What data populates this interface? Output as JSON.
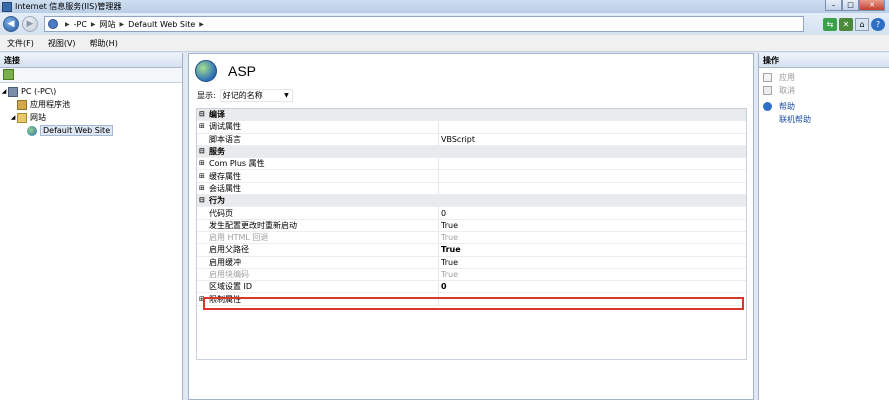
{
  "window": {
    "title": "Internet 信息服务(IIS)管理器"
  },
  "address": {
    "crumbs": [
      "-PC",
      "网站",
      "Default Web Site"
    ]
  },
  "menu": {
    "items": [
      "文件(F)",
      "视图(V)",
      "帮助(H)"
    ]
  },
  "connections": {
    "header": "连接",
    "tree": [
      {
        "label": "PC (-PC\\)",
        "icon": "server-icon",
        "toggle": "◢"
      },
      {
        "label": "应用程序池",
        "icon": "app-pool-icon",
        "toggle": ""
      },
      {
        "label": "网站",
        "icon": "sites-folder-icon",
        "toggle": "◢"
      },
      {
        "label": "Default Web Site",
        "icon": "website-globe-icon",
        "toggle": "",
        "selected": true
      }
    ]
  },
  "feature": {
    "title": "ASP",
    "display_label": "显示:",
    "display_value": "好记的名称",
    "rows": [
      {
        "type": "cat",
        "toggle": "⊟",
        "name": "编译",
        "value": ""
      },
      {
        "type": "sub",
        "toggle": "⊞",
        "name": "调试属性",
        "value": ""
      },
      {
        "type": "prop",
        "name": "脚本语言",
        "value": "VBScript"
      },
      {
        "type": "cat",
        "toggle": "⊟",
        "name": "服务",
        "value": ""
      },
      {
        "type": "sub",
        "toggle": "⊞",
        "name": "Com Plus 属性",
        "value": ""
      },
      {
        "type": "sub",
        "toggle": "⊞",
        "name": "缓存属性",
        "value": ""
      },
      {
        "type": "sub",
        "toggle": "⊞",
        "name": "会话属性",
        "value": ""
      },
      {
        "type": "cat",
        "toggle": "⊟",
        "name": "行为",
        "value": ""
      },
      {
        "type": "prop",
        "name": "代码页",
        "value": "0"
      },
      {
        "type": "prop",
        "name": "发生配置更改时重新启动",
        "value": "True"
      },
      {
        "type": "prop",
        "name": "启用 HTML 回退",
        "value": "True",
        "disabled": true
      },
      {
        "type": "prop",
        "name": "启用父路径",
        "value": "True",
        "bold": true,
        "highlight": true
      },
      {
        "type": "prop",
        "name": "启用缓冲",
        "value": "True"
      },
      {
        "type": "prop",
        "name": "启用块编码",
        "value": "True",
        "disabled": true
      },
      {
        "type": "prop",
        "name": "区域设置 ID",
        "value": "0",
        "bold": true
      },
      {
        "type": "sub",
        "toggle": "⊞",
        "name": "限制属性",
        "value": ""
      }
    ]
  },
  "actions": {
    "header": "操作",
    "items": [
      {
        "label": "应用",
        "icon": "apply-icon",
        "disabled": true
      },
      {
        "label": "取消",
        "icon": "cancel-icon",
        "disabled": true
      },
      {
        "label": "帮助",
        "icon": "help-icon",
        "disabled": false
      },
      {
        "label": "联机帮助",
        "icon": "",
        "disabled": false
      }
    ]
  },
  "colors": {
    "highlight_border": "#d9362c",
    "link": "#1a4fa0"
  }
}
